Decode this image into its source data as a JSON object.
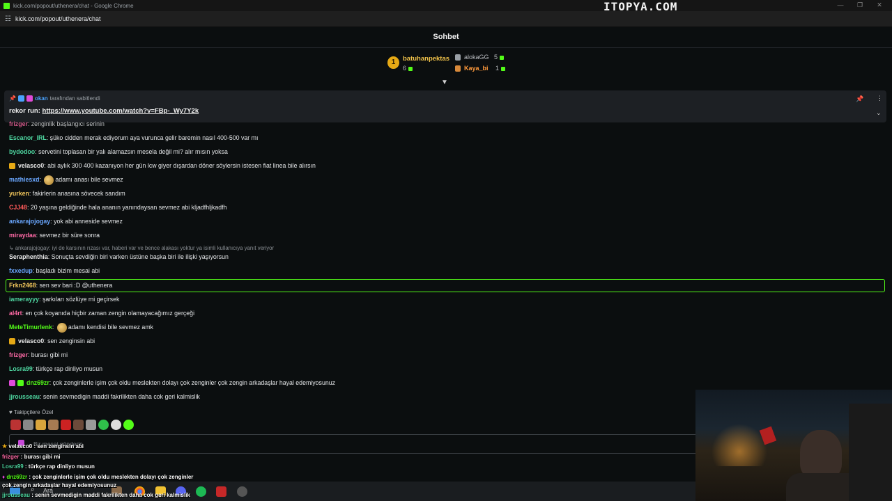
{
  "window": {
    "title": "kick.com/popout/uthenera/chat - Google Chrome",
    "url": "kick.com/popout/uthenera/chat",
    "watermark": "ITOPYA.COM"
  },
  "chat_header": {
    "title": "Sohbet"
  },
  "leaderboard": {
    "first": {
      "rank": "1",
      "name": "batuhanpektas",
      "count": "6"
    },
    "second": {
      "name": "alokaGG",
      "count": "5"
    },
    "third": {
      "name": "Kaya_bi",
      "count": "1"
    }
  },
  "pinned": {
    "pinner": "okan",
    "pinned_by_text": "tarafından sabitlendi",
    "label": "rekor run:",
    "link": "https://www.youtube.com/watch?v=FBp-_Wy7Y2k"
  },
  "messages": [
    {
      "user": "Escanor_IRL",
      "color": "#4ed6a0",
      "text": "şüko cidden merak ediyorum aya vurunca gelir baremin nasıl 400-500 var mı"
    },
    {
      "user": "bydodoo",
      "color": "#4ed6a0",
      "text": "servetini toplasan bir yalı alamazsın mesela değil mi? alır mısın yoksa"
    },
    {
      "user": "velasco0",
      "color": "#e9e9e9",
      "text": "abi aylık 300 400 kazanıyon her gün lcw giyer dışardan döner söylersin istesen fiat linea bile alırsın"
    },
    {
      "user": "mathiesxd",
      "color": "#6aa7ff",
      "text": "adamı anası bile sevmez"
    },
    {
      "user": "yurken",
      "color": "#f2c75c",
      "text": "fakirlerin anasına sövecek sandım"
    },
    {
      "user": "CJJ48",
      "color": "#ff5a5a",
      "text": "20 yaşına geldiğinde hala ananın yanındaysan sevmez abi kljadfhljkadfh"
    },
    {
      "user": "ankarajojogay",
      "color": "#6aa7ff",
      "text": "yok abi anneside sevmez"
    },
    {
      "user": "miraydaa",
      "color": "#ff6aa6",
      "text": "sevmez bir süre sonra"
    },
    {
      "user": "Seraphenthia",
      "color": "#e9e9e9",
      "text": "Sonuçta sevdiğin biri varken üstüne başka biri ile ilişki yaşıyorsun"
    },
    {
      "user": "fxxedup",
      "color": "#6aa7ff",
      "text": "başladı bizim mesai abi"
    },
    {
      "user": "Frkn2468",
      "color": "#f2c75c",
      "text": "sen sev bari :D @uthenera"
    },
    {
      "user": "iamerayyy",
      "color": "#4ed6a0",
      "text": "şarkıları sözlüye mi geçirsek"
    },
    {
      "user": "al4rt",
      "color": "#ff6aa6",
      "text": "en çok koyanıda hiçbir zaman zengin olamayacağımız gerçeği"
    },
    {
      "user": "MeteTimurlenk",
      "color": "#53fc18",
      "text": "adamı kendisi bile sevmez amk"
    },
    {
      "user": "velasco0",
      "color": "#e9e9e9",
      "text": "sen zenginsin abi"
    },
    {
      "user": "frizger",
      "color": "#ff6aa6",
      "text": "burası gibi mi"
    },
    {
      "user": "Losra99",
      "color": "#4ed6a0",
      "text": "türkçe rap dinliyo musun"
    },
    {
      "user": "dnz69zr",
      "color": "#53fc18",
      "text": "çok zenginlerle işim çok oldu meslekten dolayı çok zenginler çok zengin arkadaşlar hayal edemiyosunuz"
    },
    {
      "user": "jjrousseau",
      "color": "#4ed6a0",
      "text": "senin sevmedigin maddi fakrilikten daha cok geri kalmislik"
    }
  ],
  "partial_top": {
    "user": "frizger",
    "text": "zenginlik başlangıcı serinin"
  },
  "reply": {
    "text": "ankarajojogay: iyi de karsının rızası var, haberi var ve bence alakası yoktur ya  isimli kullanıcıya yanıt veriyor"
  },
  "followers_label": "Takipçilere Özel",
  "input": {
    "placeholder": "Bir mesaj gönderin"
  },
  "overlay": [
    {
      "user": "velasco0",
      "text": "sen zenginsin abi"
    },
    {
      "user": "frizger",
      "text": "burası gibi mi"
    },
    {
      "user": "Losra99",
      "text": "türkçe rap dinliyo musun"
    },
    {
      "user": "dnz69zr",
      "text": "çok zenginlerle işim çok oldu meslekten dolayı çok zenginler"
    },
    {
      "user": "",
      "text": "çok zengin arkadaşlar hayal edemiyosunuz"
    },
    {
      "user": "jjrousseau",
      "text": "senin sevmedigin maddi fakrilikten daha cok geri kalmislik"
    }
  ],
  "taskbar": {
    "search_label": "Ara"
  },
  "colors": {
    "accent": "#53fc18",
    "background": "#0b0e0f",
    "gold": "#e6a915"
  }
}
